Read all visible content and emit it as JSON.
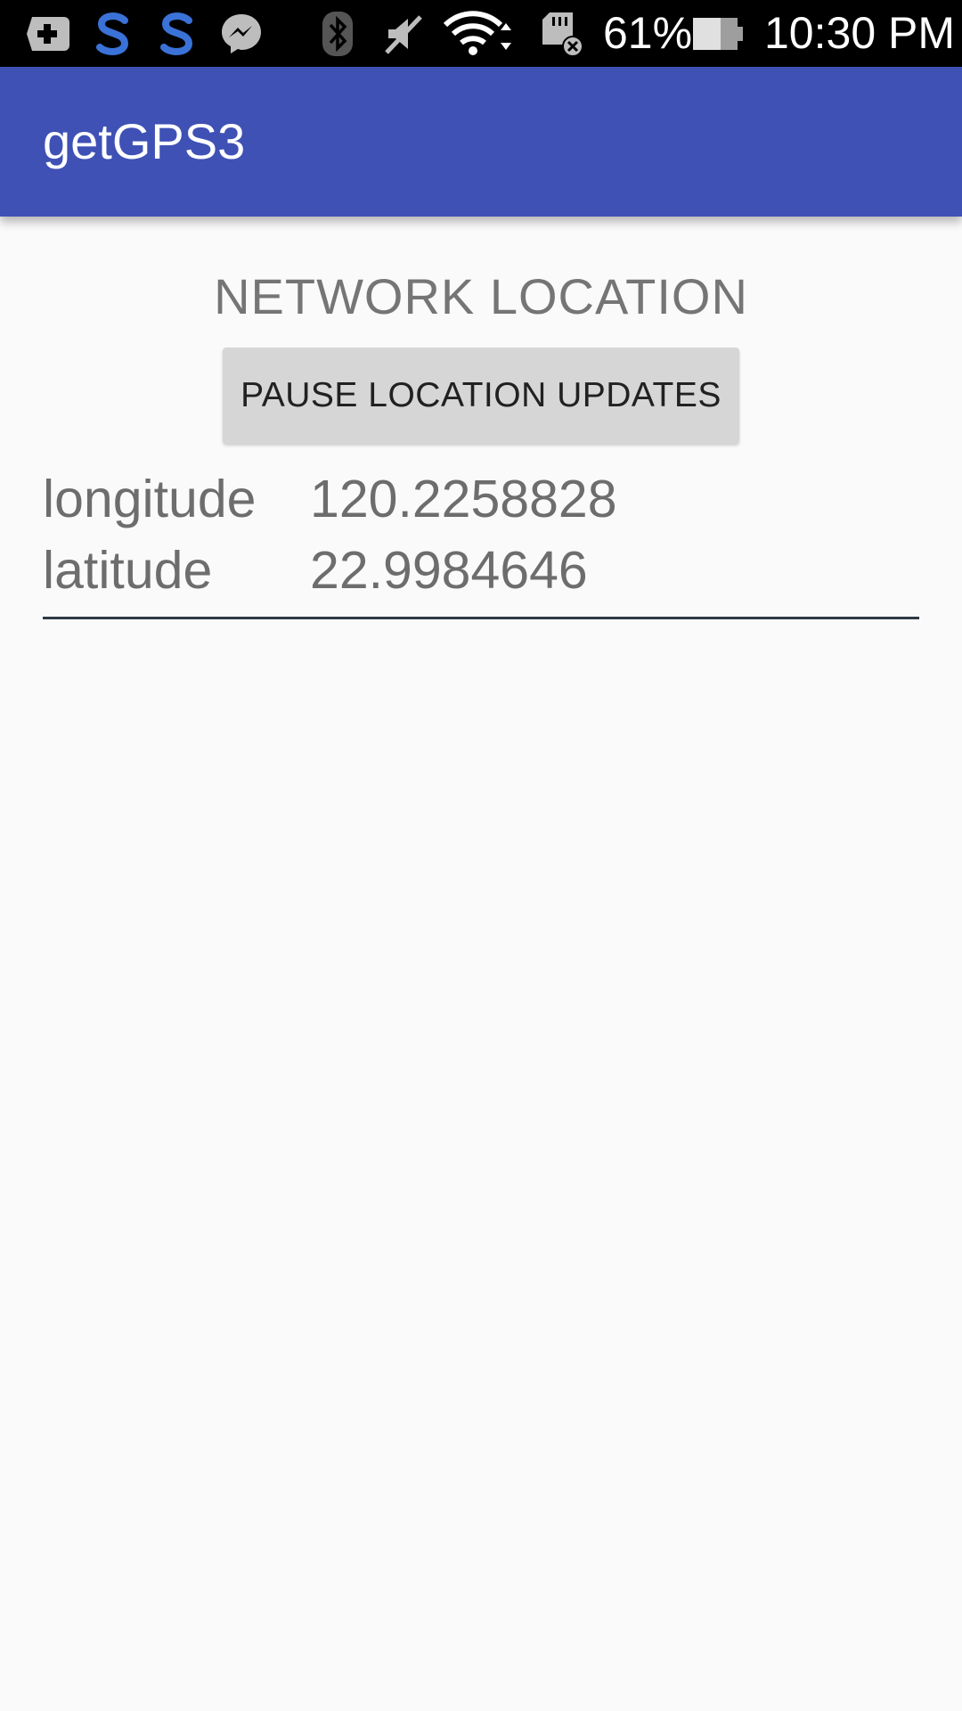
{
  "status_bar": {
    "icons": [
      "add-box-icon",
      "skype-icon",
      "skype-icon",
      "messenger-icon",
      "bluetooth-icon",
      "mute-icon",
      "wifi-icon",
      "sd-card-icon",
      "battery-icon"
    ],
    "battery_percent": "61%",
    "time": "10:30 PM"
  },
  "app_bar": {
    "title": "getGPS3",
    "color": "#3f51b5"
  },
  "main": {
    "section_title": "NETWORK LOCATION",
    "pause_button_label": "PAUSE LOCATION UPDATES",
    "rows": [
      {
        "label": "longitude",
        "value": "120.2258828"
      },
      {
        "label": "latitude",
        "value": "22.9984646"
      }
    ]
  }
}
